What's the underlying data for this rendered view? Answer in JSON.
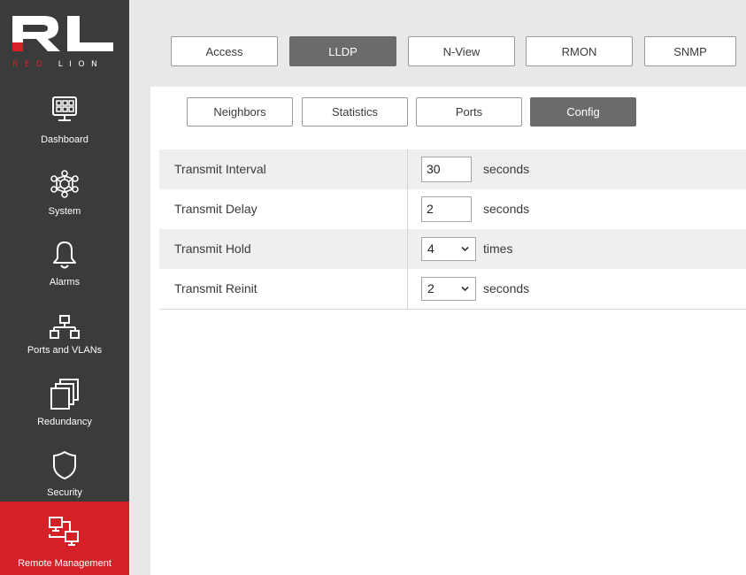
{
  "brand": {
    "logo_mark": "RL",
    "logo_text_red": "RED ",
    "logo_text_white": "LION",
    "accent": "#d42027"
  },
  "sidebar": {
    "items": [
      {
        "label": "Dashboard",
        "icon": "dashboard-icon"
      },
      {
        "label": "System",
        "icon": "system-icon"
      },
      {
        "label": "Alarms",
        "icon": "bell-icon"
      },
      {
        "label": "Ports and VLANs",
        "icon": "network-icon"
      },
      {
        "label": "Redundancy",
        "icon": "redundancy-icon"
      },
      {
        "label": "Security",
        "icon": "shield-icon"
      },
      {
        "label": "Remote Management",
        "icon": "remote-management-icon",
        "active": true
      }
    ]
  },
  "tabs": [
    {
      "label": "Access"
    },
    {
      "label": "LLDP",
      "active": true
    },
    {
      "label": "N-View"
    },
    {
      "label": "RMON"
    },
    {
      "label": "SNMP"
    }
  ],
  "subtabs": [
    {
      "label": "Neighbors"
    },
    {
      "label": "Statistics"
    },
    {
      "label": "Ports"
    },
    {
      "label": "Config",
      "active": true
    }
  ],
  "config": {
    "rows": [
      {
        "label": "Transmit Interval",
        "value": "30",
        "control": "input",
        "unit": "seconds"
      },
      {
        "label": "Transmit Delay",
        "value": "2",
        "control": "input",
        "unit": "seconds"
      },
      {
        "label": "Transmit Hold",
        "value": "4",
        "control": "select",
        "unit": "times"
      },
      {
        "label": "Transmit Reinit",
        "value": "2",
        "control": "select",
        "unit": "seconds"
      }
    ]
  }
}
